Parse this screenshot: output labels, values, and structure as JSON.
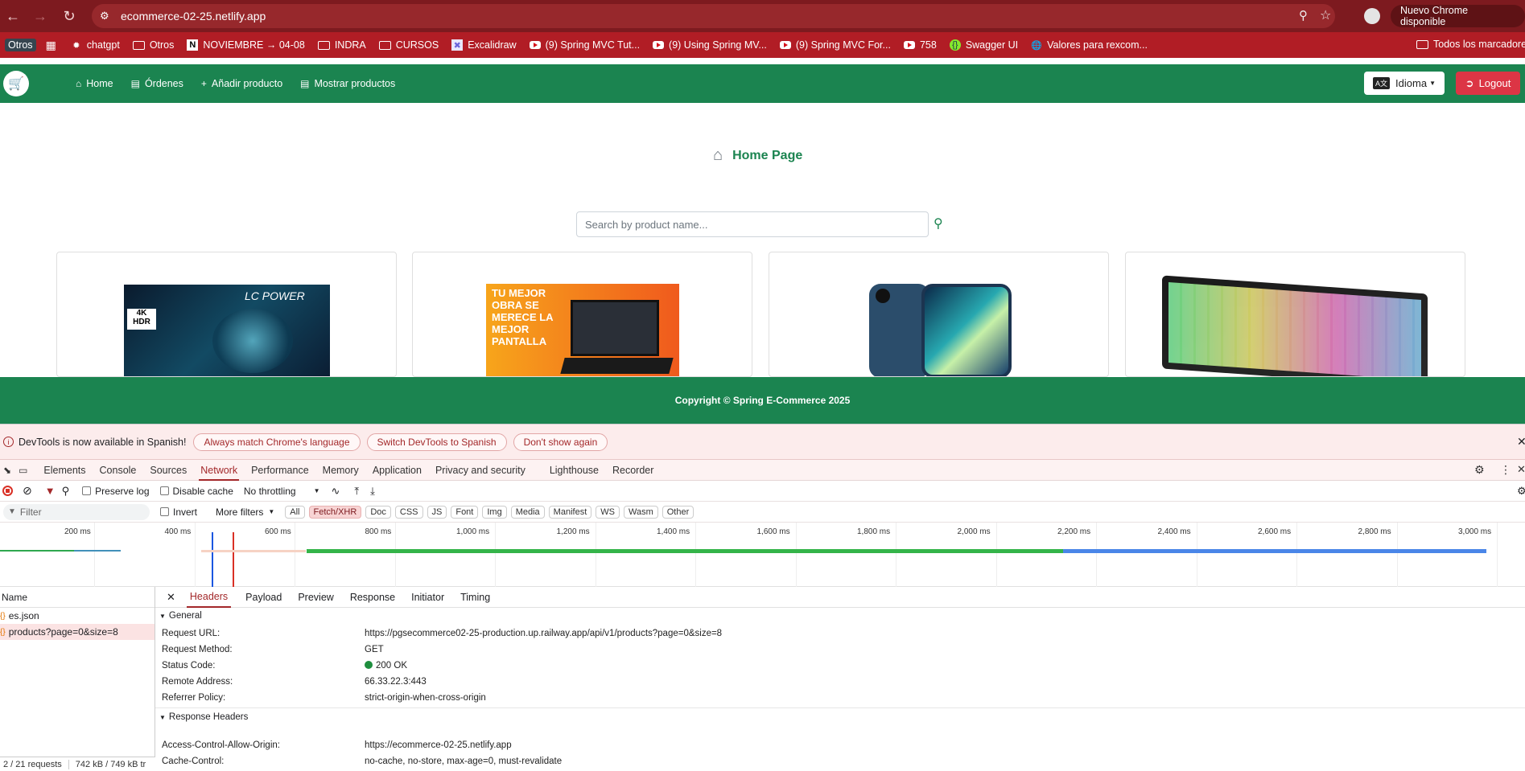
{
  "browser": {
    "url": "ecommerce-02-25.netlify.app",
    "update_label": "Nuevo Chrome disponible",
    "bookmarks": [
      {
        "label": "Otros",
        "kind": "badge"
      },
      {
        "label": "chatgpt",
        "kind": "chatgpt-icon"
      },
      {
        "label": "Otros",
        "kind": "folder"
      },
      {
        "label": "NOVIEMBRE → 04-08",
        "kind": "notion-icon"
      },
      {
        "label": "INDRA",
        "kind": "folder"
      },
      {
        "label": "CURSOS",
        "kind": "folder"
      },
      {
        "label": "Excalidraw",
        "kind": "excalidraw-icon"
      },
      {
        "label": "(9) Spring MVC Tut...",
        "kind": "youtube"
      },
      {
        "label": "(9) Using Spring MV...",
        "kind": "youtube"
      },
      {
        "label": "(9) Spring MVC For...",
        "kind": "youtube"
      },
      {
        "label": "758",
        "kind": "youtube"
      },
      {
        "label": "Swagger UI",
        "kind": "swagger-icon"
      },
      {
        "label": "Valores para rexcom...",
        "kind": "globe-icon"
      }
    ],
    "all_bookmarks": "Todos los marcadores"
  },
  "app": {
    "nav": [
      {
        "label": "Home",
        "icon": "home-icon"
      },
      {
        "label": "Órdenes",
        "icon": "list-icon"
      },
      {
        "label": "Añadir producto",
        "icon": "plus-icon"
      },
      {
        "label": "Mostrar productos",
        "icon": "table-icon"
      }
    ],
    "idioma": "Idioma",
    "logout": "Logout",
    "home_title": "Home Page",
    "search_placeholder": "Search by product name...",
    "products": [
      {
        "name": "monitor",
        "text": "LC POWER"
      },
      {
        "name": "laptop",
        "text": "TU MEJOR OBRA SE MERECE LA MEJOR PANTALLA"
      },
      {
        "name": "iphone",
        "text": ""
      },
      {
        "name": "keyboard",
        "text": ""
      }
    ],
    "footer": "Copyright © Spring E-Commerce 2025"
  },
  "devtools": {
    "info": "DevTools is now available in Spanish!",
    "info_buttons": [
      "Always match Chrome's language",
      "Switch DevTools to Spanish",
      "Don't show again"
    ],
    "tabs": [
      "Elements",
      "Console",
      "Sources",
      "Network",
      "Performance",
      "Memory",
      "Application",
      "Privacy and security",
      "Lighthouse",
      "Recorder"
    ],
    "active_tab": "Network",
    "preserve_log": "Preserve log",
    "disable_cache": "Disable cache",
    "throttling": "No throttling",
    "filter_placeholder": "Filter",
    "invert": "Invert",
    "more_filters": "More filters",
    "type_filters": [
      "All",
      "Fetch/XHR",
      "Doc",
      "CSS",
      "JS",
      "Font",
      "Img",
      "Media",
      "Manifest",
      "WS",
      "Wasm",
      "Other"
    ],
    "active_type": "Fetch/XHR",
    "timeline_ticks": [
      "200 ms",
      "400 ms",
      "600 ms",
      "800 ms",
      "1,000 ms",
      "1,200 ms",
      "1,400 ms",
      "1,600 ms",
      "1,800 ms",
      "2,000 ms",
      "2,200 ms",
      "2,400 ms",
      "2,600 ms",
      "2,800 ms",
      "3,000 ms"
    ],
    "name_header": "Name",
    "requests": [
      "es.json",
      "products?page=0&size=8"
    ],
    "detail_tabs": [
      "Headers",
      "Payload",
      "Preview",
      "Response",
      "Initiator",
      "Timing"
    ],
    "general_label": "General",
    "general": [
      {
        "k": "Request URL:",
        "v": "https://pgsecommerce02-25-production.up.railway.app/api/v1/products?page=0&size=8"
      },
      {
        "k": "Request Method:",
        "v": "GET"
      },
      {
        "k": "Status Code:",
        "v": "200 OK"
      },
      {
        "k": "Remote Address:",
        "v": "66.33.22.3:443"
      },
      {
        "k": "Referrer Policy:",
        "v": "strict-origin-when-cross-origin"
      }
    ],
    "response_headers_label": "Response Headers",
    "response_headers": [
      {
        "k": "Access-Control-Allow-Origin:",
        "v": "https://ecommerce-02-25.netlify.app"
      },
      {
        "k": "Cache-Control:",
        "v": "no-cache, no-store, max-age=0, must-revalidate"
      }
    ],
    "status": "2 / 21 requests",
    "transfer": "742 kB / 749 kB tr"
  }
}
